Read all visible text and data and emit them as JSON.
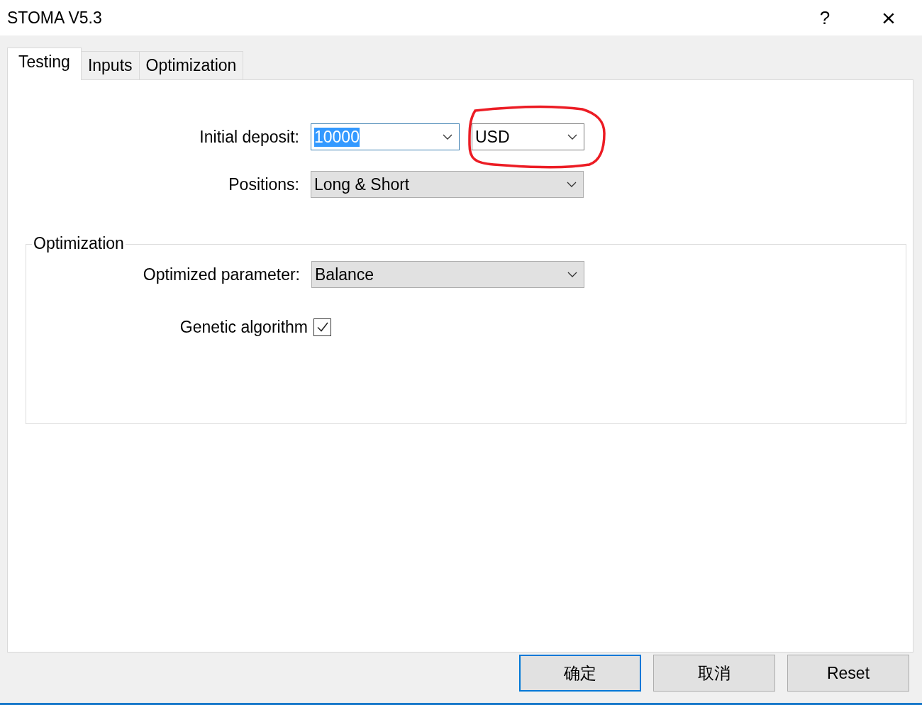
{
  "window": {
    "title": "STOMA V5.3",
    "help": "?",
    "close": "×"
  },
  "tabs": [
    {
      "label": "Testing",
      "selected": true
    },
    {
      "label": "Inputs",
      "selected": false
    },
    {
      "label": "Optimization",
      "selected": false
    }
  ],
  "initial_deposit": {
    "label": "Initial deposit:",
    "value": "10000",
    "text_selected": true,
    "currency": "USD"
  },
  "positions": {
    "label": "Positions:",
    "value": "Long & Short"
  },
  "optimization": {
    "title": "Optimization",
    "parameter_label": "Optimized parameter:",
    "parameter": "Balance",
    "genetic": {
      "label": "Genetic algorithm",
      "checked": true
    }
  },
  "annotations": [
    {
      "kind": "freehand-circle"
    }
  ],
  "buttons": [
    {
      "label": "确定",
      "default": true
    },
    {
      "label": "取消",
      "default": false
    },
    {
      "label": "Reset",
      "default": false
    }
  ]
}
